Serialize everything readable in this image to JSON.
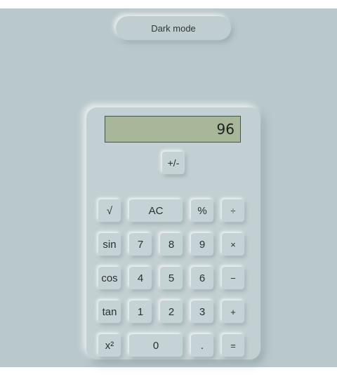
{
  "header": {
    "mode_toggle_label": "Dark mode"
  },
  "display": {
    "value": "96"
  },
  "buttons": {
    "sign": "+/-",
    "sqrt": "√",
    "ac": "AC",
    "percent": "%",
    "divide": "÷",
    "sin": "sin",
    "seven": "7",
    "eight": "8",
    "nine": "9",
    "multiply": "×",
    "cos": "cos",
    "four": "4",
    "five": "5",
    "six": "6",
    "minus": "−",
    "tan": "tan",
    "one": "1",
    "two": "2",
    "three": "3",
    "plus": "+",
    "square": "x²",
    "zero": "0",
    "decimal": ".",
    "equals": "="
  },
  "colors": {
    "background": "#b9c8cc",
    "calculator_body": "#c3d0d3",
    "display_screen": "#a8b79a",
    "text": "#2a2f31"
  }
}
